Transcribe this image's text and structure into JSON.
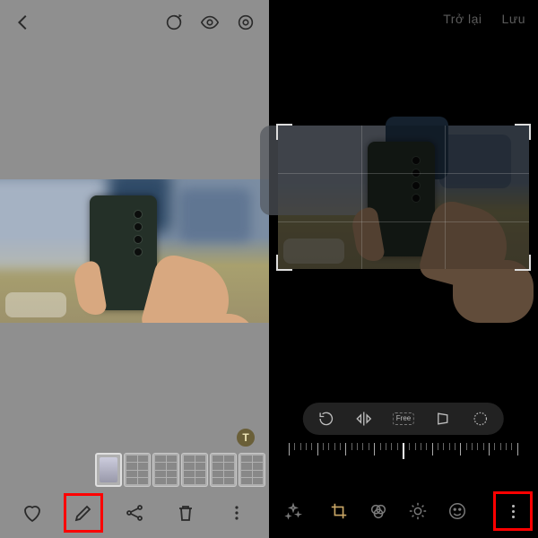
{
  "left": {
    "topbar": {
      "back_icon": "chevron-left",
      "action_icons": [
        "motion-photo",
        "visibility",
        "bixby-vision"
      ]
    },
    "timestamp_badge": "T",
    "thumbstrip_count": 6,
    "bottombar": {
      "favorite_icon": "heart",
      "edit_icon": "pencil",
      "share_icon": "share",
      "delete_icon": "trash",
      "more_icon": "more-vertical"
    }
  },
  "right": {
    "topbar": {
      "back_label": "Trở lại",
      "save_label": "Lưu"
    },
    "transform": {
      "rotate_icon": "rotate-ccw",
      "flip_icon": "flip-horizontal",
      "ratio_label": "Free",
      "perspective_icon": "perspective",
      "straighten_icon": "straighten-wheel"
    },
    "ruler": {
      "ticks": 41,
      "major_every": 5
    },
    "bottombar": {
      "magic_icon": "auto-enhance",
      "tabs": [
        "crop",
        "filters",
        "adjust",
        "stickers"
      ],
      "active_tab": "crop",
      "more_icon": "more-vertical"
    }
  }
}
